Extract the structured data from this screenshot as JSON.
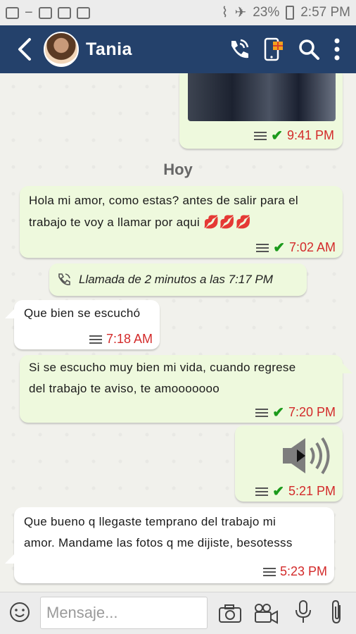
{
  "status_bar": {
    "battery": "23%",
    "time": "2:57 PM"
  },
  "header": {
    "contact_name": "Tania"
  },
  "chat": {
    "day_separator": "Hoy",
    "messages": [
      {
        "time": "9:41 PM"
      },
      {
        "text_line1": "Hola mi amor, como estas? antes de salir para el",
        "text_line2": "trabajo te voy a llamar por aqui",
        "emoji": "💋💋💋",
        "time": "7:02 AM"
      },
      {
        "text": "Llamada de 2 minutos a las 7:17 PM"
      },
      {
        "text": "Que bien se escuchó",
        "time": "7:18 AM"
      },
      {
        "text_line1": "Si se escucho muy bien mi vida, cuando regrese",
        "text_line2": "del trabajo te aviso, te amooooooo",
        "time": "7:20 PM"
      },
      {
        "time": "5:21 PM"
      },
      {
        "text_line1": "Que bueno q llegaste temprano del trabajo mi",
        "text_line2": "amor. Mandame las fotos q me dijiste, besotesss",
        "time": "5:23 PM"
      }
    ]
  },
  "input_bar": {
    "placeholder": "Mensaje..."
  },
  "colors": {
    "header_bg": "#24416b",
    "outgoing_bubble": "#eef9dd",
    "incoming_bubble": "#ffffff",
    "time_red": "#d32a2a",
    "tick_green": "#1b9a1b"
  }
}
